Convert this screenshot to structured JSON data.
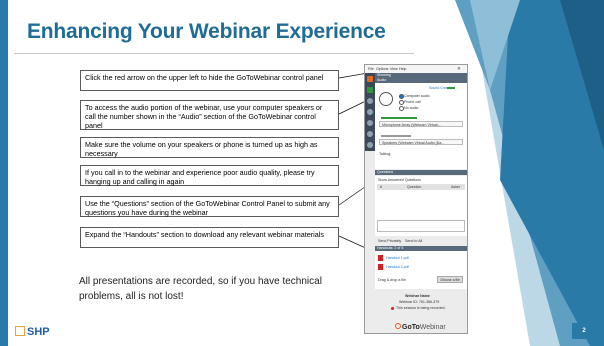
{
  "slide": {
    "title": "Enhancing Your Webinar Experience",
    "page_number": "2",
    "logo_text": "SHP"
  },
  "instructions": [
    "Click the red arrow on the upper left to hide the GoToWebinar control panel",
    "To access the audio portion of the webinar, use your computer speakers or call the number shown in the “Audio” section of the GoToWebinar control panel",
    "Make sure the volume on your speakers or phone is turned up as high as necessary",
    "If you call in to the webinar and experience poor audio quality, please try hanging up and calling in again",
    "Use the “Questions” section of the GoToWebinar Control Panel to submit any questions you have during the webinar",
    "Expand the “Handouts” section to download any relevant webinar materials"
  ],
  "footer_note": "All presentations are recorded, so if you have technical problems, all is not lost!",
  "gtw_panel": {
    "menu": [
      "File",
      "Options",
      "View",
      "Help"
    ],
    "section_showing": "Showing",
    "section_audio": "Audio",
    "sound_check": "Sound Check",
    "audio_options": [
      "Computer audio",
      "Phone call",
      "No audio"
    ],
    "microphone": "Microphone Array (Webcam Virtual...",
    "speakers": "Speakers (Webcam Virtual Audio (Da...",
    "talking": "Talking:",
    "section_questions": "Questions",
    "show_answered": "Show Answered Questions",
    "questions_cols": [
      "#",
      "Question",
      "Asker"
    ],
    "send_privately": "Send Privately",
    "send_to_all": "Send to All",
    "section_handouts": "Handouts: 2 of 5",
    "handouts": [
      "Handout 1.pdf",
      "Handout 2.pdf"
    ],
    "drop_file": "Drag & drop a file",
    "choose_file": "Choose a file",
    "webinar_name": "Webinar Name",
    "webinar_id": "Webinar ID: 761-386-379",
    "recording": "This session is being recorded.",
    "brand": "GoTo",
    "brand_suffix": "Webinar"
  },
  "colors": {
    "title": "#1f6c95",
    "accent_blue": "#2a7aa7",
    "logo_orange": "#e9a13b"
  }
}
